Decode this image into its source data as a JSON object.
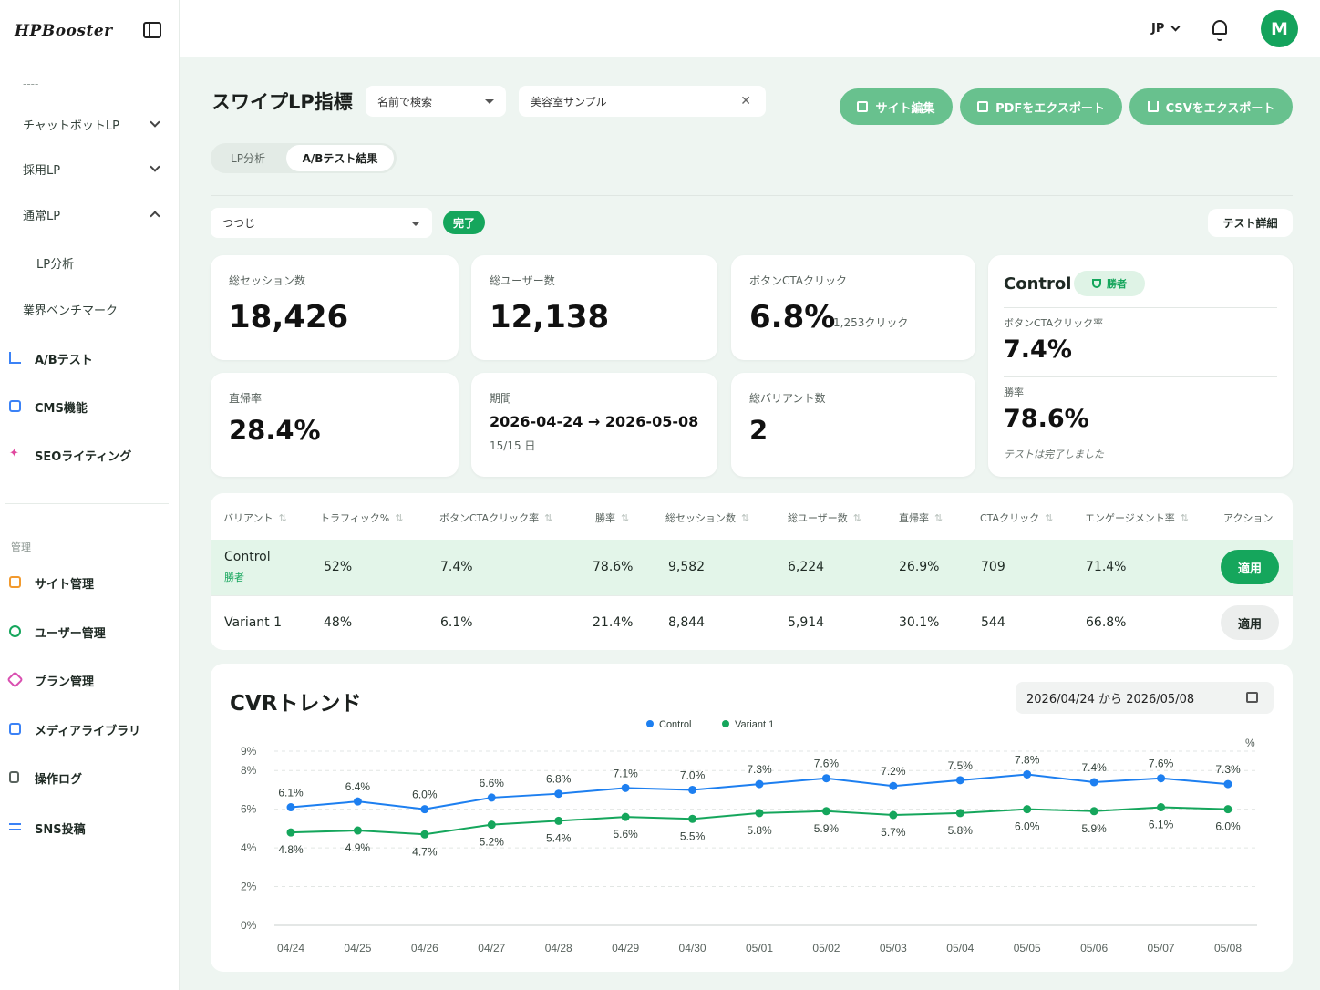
{
  "sidebar": {
    "logo": "HPBooster",
    "dashes": "----",
    "groups": [
      {
        "label": "チャットボットLP"
      },
      {
        "label": "採用LP"
      },
      {
        "label": "通常LP"
      }
    ],
    "sub_items": [
      {
        "label": "LP分析"
      },
      {
        "label": "業界ベンチマーク"
      }
    ],
    "main_items": [
      {
        "label": "A/Bテスト",
        "icon": "chart-icon",
        "color": "#3b82f6"
      },
      {
        "label": "CMS機能",
        "icon": "document-icon",
        "color": "#3b82f6"
      },
      {
        "label": "SEOライティング",
        "icon": "sparkle-icon",
        "color": "#e0479e"
      }
    ],
    "section_label": "管理",
    "admin_items": [
      {
        "label": "サイト管理",
        "icon": "browser-icon",
        "color": "#f29a2e"
      },
      {
        "label": "ユーザー管理",
        "icon": "users-icon",
        "color": "#15a65c"
      },
      {
        "label": "プラン管理",
        "icon": "tag-icon",
        "color": "#d94fb0"
      },
      {
        "label": "メディアライブラリ",
        "icon": "image-icon",
        "color": "#3b82f6"
      },
      {
        "label": "操作ログ",
        "icon": "clipboard-icon",
        "color": "#59635e"
      },
      {
        "label": "SNS投稿",
        "icon": "list-icon",
        "color": "#3b82f6"
      }
    ]
  },
  "topbar": {
    "lang": "JP",
    "avatar_initial": "M"
  },
  "header": {
    "title": "スワイプLP指標",
    "name_search": "名前で検索",
    "site_value": "美容室サンプル",
    "btn_edit": "サイト編集",
    "btn_pdf": "PDFをエクスポート",
    "btn_csv": "CSVをエクスポート"
  },
  "tabs": [
    {
      "label": "LP分析"
    },
    {
      "label": "A/Bテスト結果"
    }
  ],
  "test": {
    "selected": "つつじ",
    "status": "完了",
    "detail_button": "テスト詳細"
  },
  "stats": {
    "sessions_label": "総セッション数",
    "sessions": "18,426",
    "users_label": "総ユーザー数",
    "users": "12,138",
    "cta_label": "ボタンCTAクリック",
    "cta_rate": "6.8%",
    "cta_clicks": "1,253クリック",
    "bounce_label": "直帰率",
    "bounce": "28.4%",
    "period_label": "期間",
    "period": "2026-04-24 → 2026-05-08",
    "period_days": "15/15 日",
    "variants_label": "総バリアント数",
    "variants": "2"
  },
  "winner": {
    "name": "Control",
    "badge": "勝者",
    "cta_label": "ボタンCTAクリック率",
    "cta_rate": "7.4%",
    "win_label": "勝率",
    "win_rate": "78.6%",
    "note": "テストは完了しました"
  },
  "table": {
    "headers": [
      "バリアント",
      "トラフィック%",
      "ボタンCTAクリック率",
      "勝率",
      "総セッション数",
      "総ユーザー数",
      "直帰率",
      "CTAクリック",
      "エンゲージメント率",
      "アクション"
    ],
    "sort_icon": "⇅",
    "rows": [
      {
        "variant": "Control",
        "tag": "勝者",
        "traffic": "52%",
        "cta_rate": "7.4%",
        "win": "78.6%",
        "sessions": "9,582",
        "users": "6,224",
        "bounce": "26.9%",
        "clicks": "709",
        "engagement": "71.4%",
        "action": "適用"
      },
      {
        "variant": "Variant 1",
        "tag": "",
        "traffic": "48%",
        "cta_rate": "6.1%",
        "win": "21.4%",
        "sessions": "8,844",
        "users": "5,914",
        "bounce": "30.1%",
        "clicks": "544",
        "engagement": "66.8%",
        "action": "適用"
      }
    ]
  },
  "chart": {
    "title": "CVRトレンド",
    "date_range": "2026/04/24 から 2026/05/08",
    "unit": "%"
  },
  "chart_data": {
    "type": "line",
    "categories": [
      "04/24",
      "04/25",
      "04/26",
      "04/27",
      "04/28",
      "04/29",
      "04/30",
      "05/01",
      "05/02",
      "05/03",
      "05/04",
      "05/05",
      "05/06",
      "05/07",
      "05/08"
    ],
    "series": [
      {
        "name": "Control",
        "color": "#1d7ff0",
        "values": [
          6.1,
          6.4,
          6.0,
          6.6,
          6.8,
          7.1,
          7.0,
          7.3,
          7.6,
          7.2,
          7.5,
          7.8,
          7.4,
          7.6,
          7.3
        ]
      },
      {
        "name": "Variant 1",
        "color": "#15a65c",
        "values": [
          4.8,
          4.9,
          4.7,
          5.2,
          5.4,
          5.6,
          5.5,
          5.8,
          5.9,
          5.7,
          5.8,
          6.0,
          5.9,
          6.1,
          6.0
        ]
      }
    ],
    "yticks": [
      "0%",
      "2%",
      "4%",
      "6%",
      "8%",
      "9%"
    ],
    "ylim": [
      0,
      9
    ],
    "legend": "top-center",
    "grid": true
  }
}
